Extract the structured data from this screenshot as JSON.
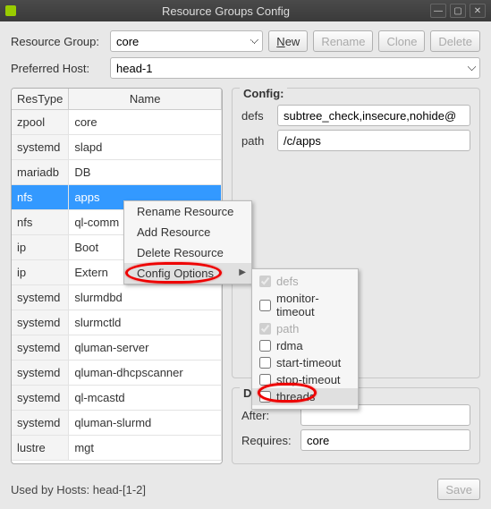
{
  "window": {
    "title": "Resource Groups Config"
  },
  "labels": {
    "resource_group": "Resource Group:",
    "preferred_host": "Preferred Host:",
    "new": "New",
    "rename": "Rename",
    "clone": "Clone",
    "delete": "Delete",
    "save": "Save"
  },
  "selects": {
    "resource_group_value": "core",
    "preferred_host_value": "head-1"
  },
  "table": {
    "headers": {
      "type": "ResType",
      "name": "Name"
    },
    "rows": [
      {
        "type": "zpool",
        "name": "core",
        "selected": false
      },
      {
        "type": "systemd",
        "name": "slapd",
        "selected": false
      },
      {
        "type": "mariadb",
        "name": "DB",
        "selected": false
      },
      {
        "type": "nfs",
        "name": "apps",
        "selected": true
      },
      {
        "type": "nfs",
        "name": "ql-common",
        "selected": false,
        "truncated": "ql-comm"
      },
      {
        "type": "ip",
        "name": "Boot",
        "selected": false
      },
      {
        "type": "ip",
        "name": "Extern",
        "selected": false
      },
      {
        "type": "systemd",
        "name": "slurmdbd",
        "selected": false
      },
      {
        "type": "systemd",
        "name": "slurmctld",
        "selected": false
      },
      {
        "type": "systemd",
        "name": "qluman-server",
        "selected": false
      },
      {
        "type": "systemd",
        "name": "qluman-dhcpscanner",
        "selected": false
      },
      {
        "type": "systemd",
        "name": "ql-mcastd",
        "selected": false
      },
      {
        "type": "systemd",
        "name": "qluman-slurmd",
        "selected": false
      },
      {
        "type": "lustre",
        "name": "mgt",
        "selected": false
      }
    ]
  },
  "context_menu": {
    "items": [
      "Rename Resource",
      "Add Resource",
      "Delete Resource",
      "Config Options"
    ]
  },
  "config_options_submenu": {
    "items": [
      {
        "label": "defs",
        "checked": true,
        "disabled": true
      },
      {
        "label": "monitor-timeout",
        "checked": false,
        "disabled": false
      },
      {
        "label": "path",
        "checked": true,
        "disabled": true
      },
      {
        "label": "rdma",
        "checked": false,
        "disabled": false
      },
      {
        "label": "start-timeout",
        "checked": false,
        "disabled": false
      },
      {
        "label": "stop-timeout",
        "checked": false,
        "disabled": false
      },
      {
        "label": "threads",
        "checked": false,
        "disabled": false,
        "hover": true
      }
    ]
  },
  "config_panel": {
    "title": "Config:",
    "fields": {
      "defs_label": "defs",
      "defs_value": "subtree_check,insecure,nohide@",
      "path_label": "path",
      "path_value": "/c/apps"
    }
  },
  "dependencies": {
    "title": "Dependencies:",
    "after_label": "After:",
    "after_value": "",
    "requires_label": "Requires:",
    "requires_value": "core"
  },
  "footer": {
    "used_by": "Used by Hosts: head-[1-2]"
  }
}
